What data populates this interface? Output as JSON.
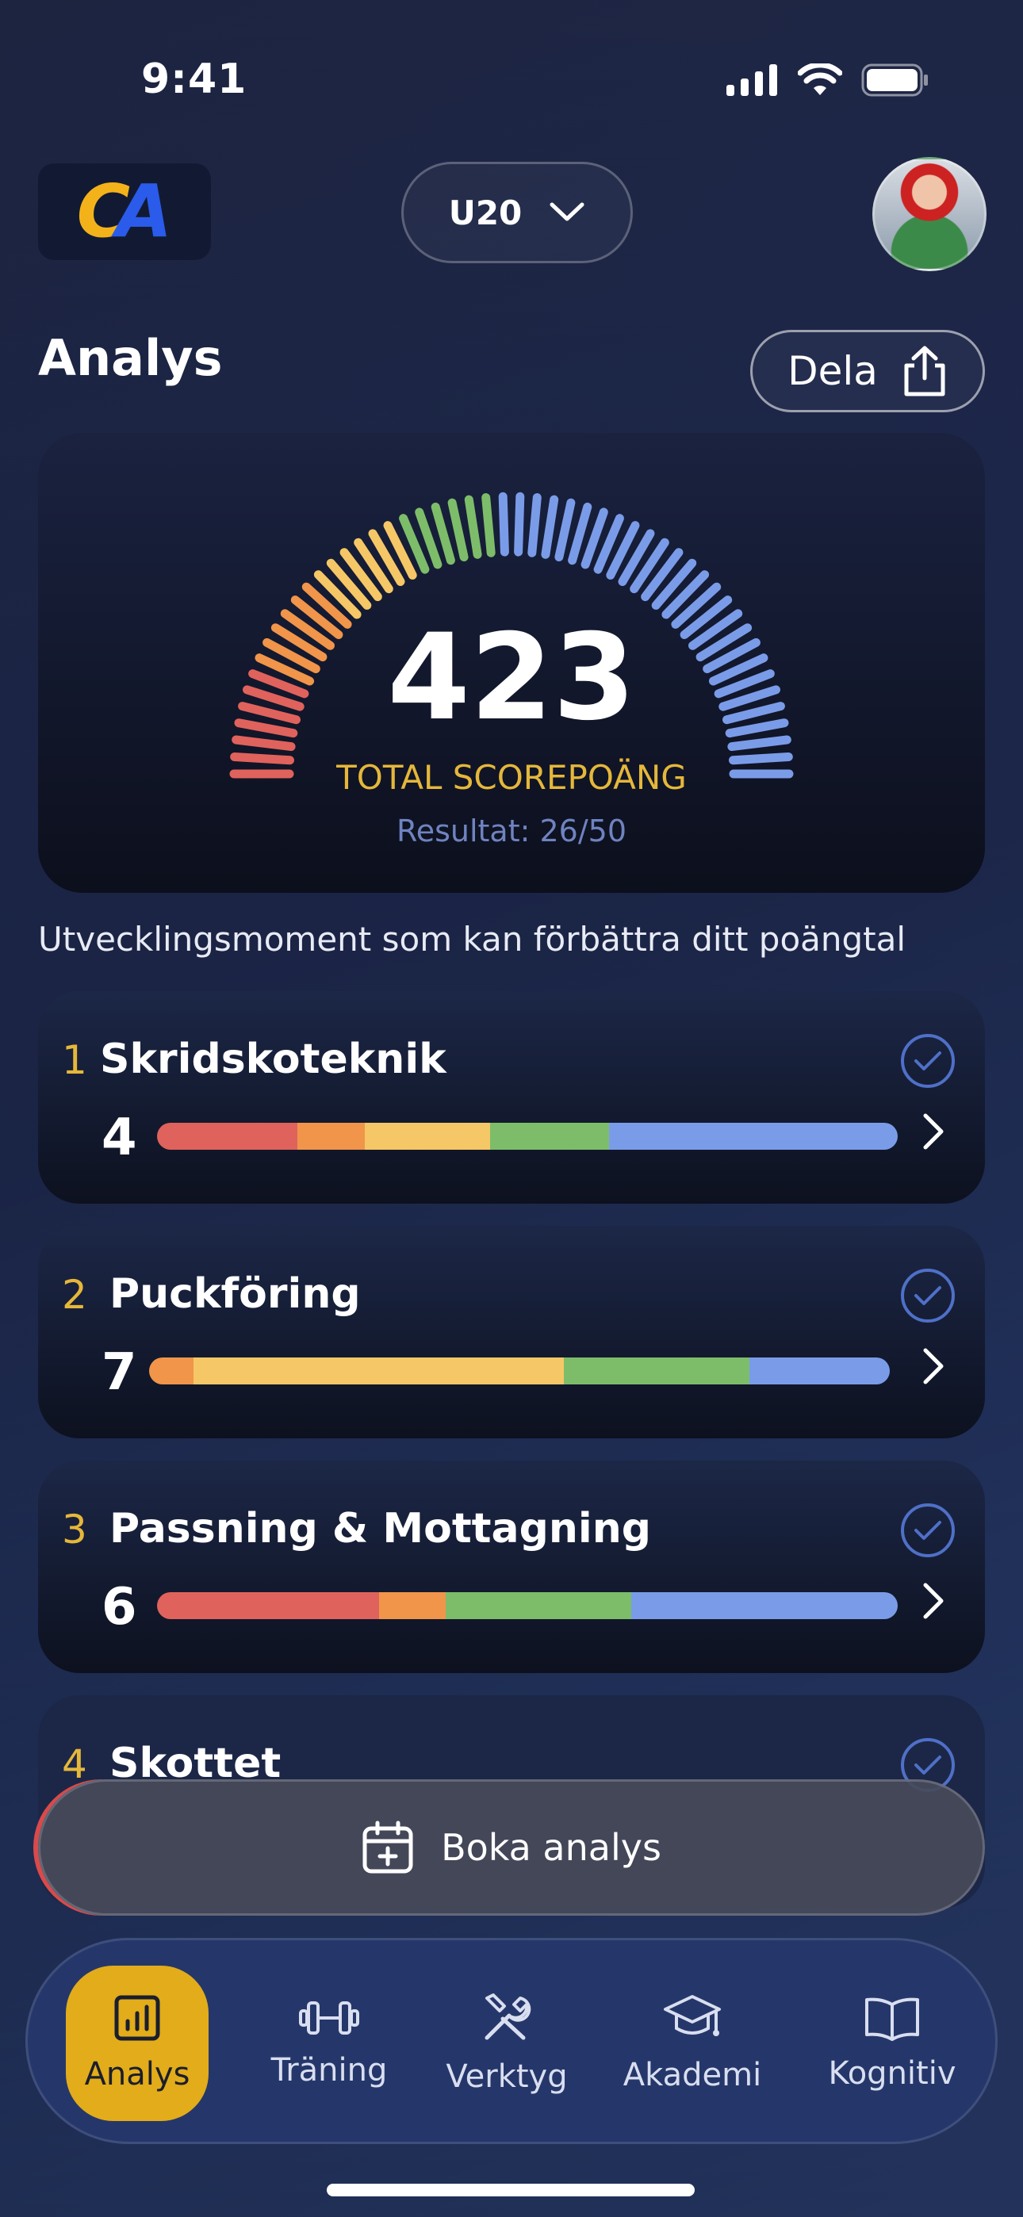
{
  "status_bar": {
    "time": "9:41"
  },
  "header": {
    "logo_c": "C",
    "logo_a": "A",
    "team": "U20"
  },
  "page": {
    "title": "Analys",
    "share_label": "Dela"
  },
  "score": {
    "value": "423",
    "label": "TOTAL SCOREPOÄNG",
    "result": "Resultat: 26/50"
  },
  "subtitle": "Utvecklingsmoment som kan förbättra ditt poängtal",
  "colors": {
    "red": "#e0625c",
    "orange": "#f0954a",
    "yellow": "#f6c766",
    "green": "#7dbd6a",
    "blue": "#7a9ce8",
    "gold": "#e5b73a"
  },
  "skills": [
    {
      "num": "1",
      "name": "Skridskoteknik",
      "score": "4",
      "segments": [
        {
          "color": "#e0625c",
          "pct": 19
        },
        {
          "color": "#f0954a",
          "pct": 9
        },
        {
          "color": "#f6c766",
          "pct": 17
        },
        {
          "color": "#7dbd6a",
          "pct": 16
        },
        {
          "color": "#7a9ce8",
          "pct": 39
        }
      ]
    },
    {
      "num": "2",
      "name": "Puckföring",
      "score": "7",
      "segments": [
        {
          "color": "#f0954a",
          "pct": 6
        },
        {
          "color": "#f6c766",
          "pct": 50
        },
        {
          "color": "#7dbd6a",
          "pct": 25
        },
        {
          "color": "#7a9ce8",
          "pct": 19
        }
      ]
    },
    {
      "num": "3",
      "name": "Passning & Mottagning",
      "score": "6",
      "segments": [
        {
          "color": "#e0625c",
          "pct": 30
        },
        {
          "color": "#f0954a",
          "pct": 9
        },
        {
          "color": "#7dbd6a",
          "pct": 25
        },
        {
          "color": "#7a9ce8",
          "pct": 36
        }
      ]
    },
    {
      "num": "4",
      "name": "Skottet",
      "score": "",
      "segments": []
    }
  ],
  "book": {
    "label": "Boka analys"
  },
  "nav": [
    {
      "label": "Analys",
      "icon": "chart-icon",
      "active": true
    },
    {
      "label": "Träning",
      "icon": "dumbbell-icon",
      "active": false
    },
    {
      "label": "Verktyg",
      "icon": "tools-icon",
      "active": false
    },
    {
      "label": "Akademi",
      "icon": "graduation-cap-icon",
      "active": false
    },
    {
      "label": "Kognitiv",
      "icon": "book-icon",
      "active": false
    }
  ]
}
